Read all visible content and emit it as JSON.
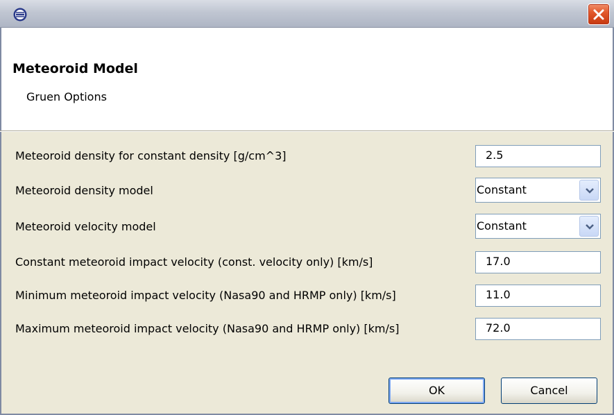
{
  "window": {
    "app_icon": "eclipse-icon",
    "close_icon": "close-icon"
  },
  "header": {
    "title": "Meteoroid Model",
    "subtitle": "Gruen Options"
  },
  "form": {
    "rows": [
      {
        "label": "Meteoroid density for constant density [g/cm^3]",
        "value": "2.5",
        "type": "text"
      },
      {
        "label": "Meteoroid density model",
        "value": "Constant",
        "type": "combo"
      },
      {
        "label": "Meteoroid velocity model",
        "value": "Constant",
        "type": "combo"
      },
      {
        "label": "Constant meteoroid impact velocity (const. velocity only) [km/s]",
        "value": "17.0",
        "type": "text"
      },
      {
        "label": "Minimum meteoroid impact velocity (Nasa90 and HRMP only) [km/s]",
        "value": "11.0",
        "type": "text"
      },
      {
        "label": "Maximum meteoroid impact velocity (Nasa90 and HRMP only) [km/s]",
        "value": "72.0",
        "type": "text"
      }
    ]
  },
  "buttons": {
    "ok": "OK",
    "cancel": "Cancel"
  },
  "colors": {
    "dialog_bg": "#ece9d8",
    "close_red": "#e35a2d",
    "field_border": "#7f9db9"
  }
}
